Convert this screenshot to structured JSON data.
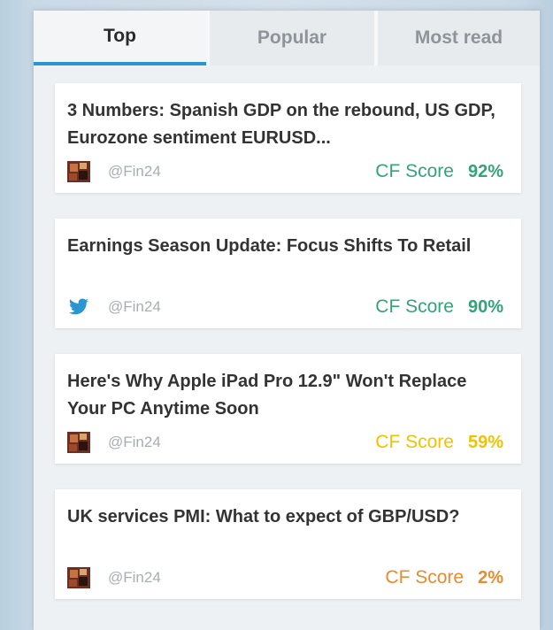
{
  "tabs": [
    {
      "label": "Top",
      "active": true
    },
    {
      "label": "Popular",
      "active": false
    },
    {
      "label": "Most read",
      "active": false
    }
  ],
  "colors": {
    "accent": "#2a95d2",
    "score_high": "#34a37a",
    "score_mid": "#f2c200",
    "score_low": "#e98a2c"
  },
  "articles": [
    {
      "title": "3 Numbers: Spanish GDP on the rebound, US GDP, Eurozone sentiment EURUSD...",
      "source_icon": "fin24-logo-icon",
      "handle": "@Fin24",
      "score_label": "CF Score",
      "score_value": "92%"
    },
    {
      "title": "Earnings Season Update: Focus Shifts To Retail",
      "source_icon": "twitter-bird-icon",
      "handle": "@Fin24",
      "score_label": "CF Score",
      "score_value": "90%"
    },
    {
      "title": "Here's Why Apple iPad Pro 12.9\" Won't Replace Your PC Anytime Soon",
      "source_icon": "fin24-logo-icon",
      "handle": "@Fin24",
      "score_label": "CF Score",
      "score_value": "59%"
    },
    {
      "title": "UK services PMI: What to expect of GBP/USD?",
      "source_icon": "fin24-logo-icon",
      "handle": "@Fin24",
      "score_label": "CF Score",
      "score_value": "2%"
    }
  ]
}
